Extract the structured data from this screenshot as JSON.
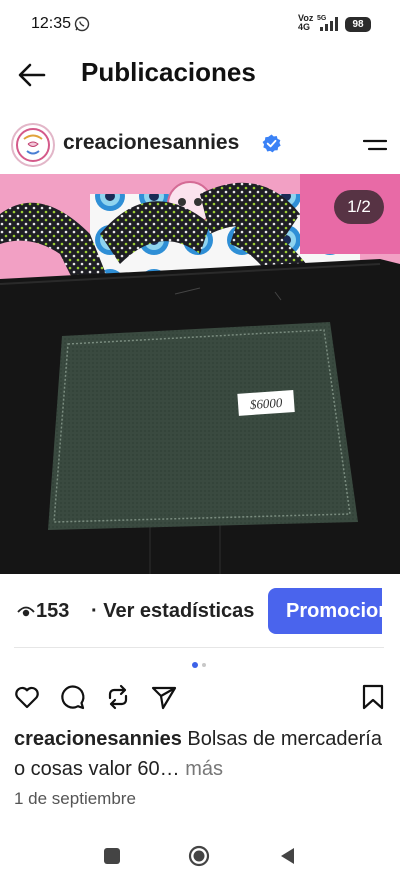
{
  "status": {
    "time": "12:35",
    "network_top": "Voz",
    "network_bottom": "4G",
    "network_small": "5G",
    "battery": "98"
  },
  "header": {
    "title": "Publicaciones"
  },
  "post": {
    "username": "creacionesannies",
    "image_counter": "1/2",
    "price_tag": "$6000",
    "views": "153",
    "stats_link": "· Ver estadísticas",
    "promote_label": "Promocionar",
    "caption_user": "creacionesannies",
    "caption_text": " Bolsas de mercadería o cosas valor 60…",
    "caption_more": " más",
    "date": "1 de septiembre"
  },
  "icons": {
    "back": "arrow-left",
    "verified": "verified-badge",
    "menu": "hamburger",
    "views": "eye",
    "like": "heart",
    "comment": "speech-bubble",
    "repost": "repost-arrows",
    "share": "paper-plane",
    "save": "bookmark"
  },
  "colors": {
    "accent": "#4a64ed",
    "verified": "#3b82f6"
  }
}
